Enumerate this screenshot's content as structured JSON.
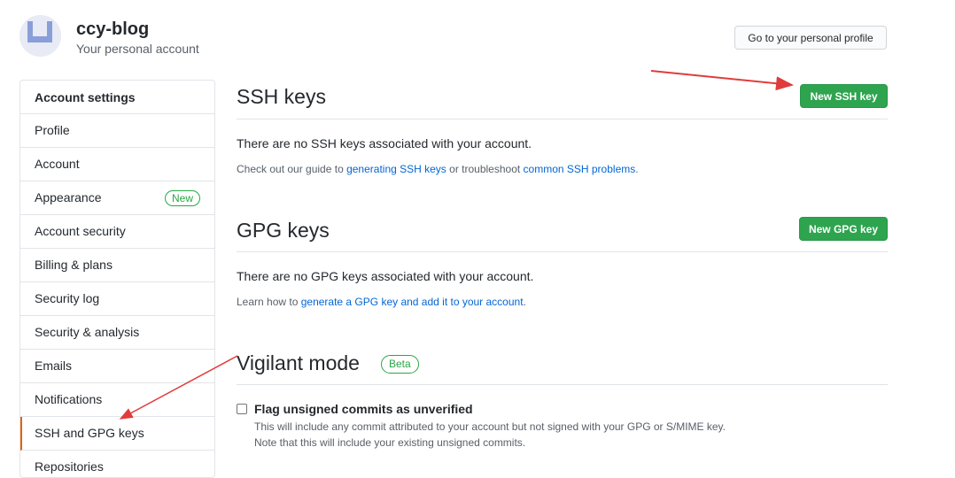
{
  "account": {
    "name": "ccy-blog",
    "subtitle": "Your personal account",
    "profile_button": "Go to your personal profile"
  },
  "sidebar": {
    "heading": "Account settings",
    "items": [
      {
        "label": "Profile"
      },
      {
        "label": "Account"
      },
      {
        "label": "Appearance",
        "badge": "New"
      },
      {
        "label": "Account security"
      },
      {
        "label": "Billing & plans"
      },
      {
        "label": "Security log"
      },
      {
        "label": "Security & analysis"
      },
      {
        "label": "Emails"
      },
      {
        "label": "Notifications"
      },
      {
        "label": "SSH and GPG keys",
        "selected": true
      },
      {
        "label": "Repositories"
      }
    ]
  },
  "ssh": {
    "title": "SSH keys",
    "button": "New SSH key",
    "empty_message": "There are no SSH keys associated with your account.",
    "guide_prefix": "Check out our guide to ",
    "guide_link": "generating SSH keys",
    "guide_middle": " or troubleshoot ",
    "guide_link2": "common SSH problems",
    "guide_suffix": "."
  },
  "gpg": {
    "title": "GPG keys",
    "button": "New GPG key",
    "empty_message": "There are no GPG keys associated with your account.",
    "learn_prefix": "Learn how to ",
    "learn_link": "generate a GPG key and add it to your account",
    "learn_suffix": "."
  },
  "vigilant": {
    "title": "Vigilant mode",
    "badge": "Beta",
    "checkbox_label": "Flag unsigned commits as unverified",
    "checkbox_checked": false,
    "desc_line1": "This will include any commit attributed to your account but not signed with your GPG or S/MIME key.",
    "desc_line2": "Note that this will include your existing unsigned commits."
  },
  "colors": {
    "accent_green": "#2ea44f",
    "link_blue": "#0366d6",
    "selected_marker": "#e36209",
    "annotation_red": "#e03c3c"
  }
}
